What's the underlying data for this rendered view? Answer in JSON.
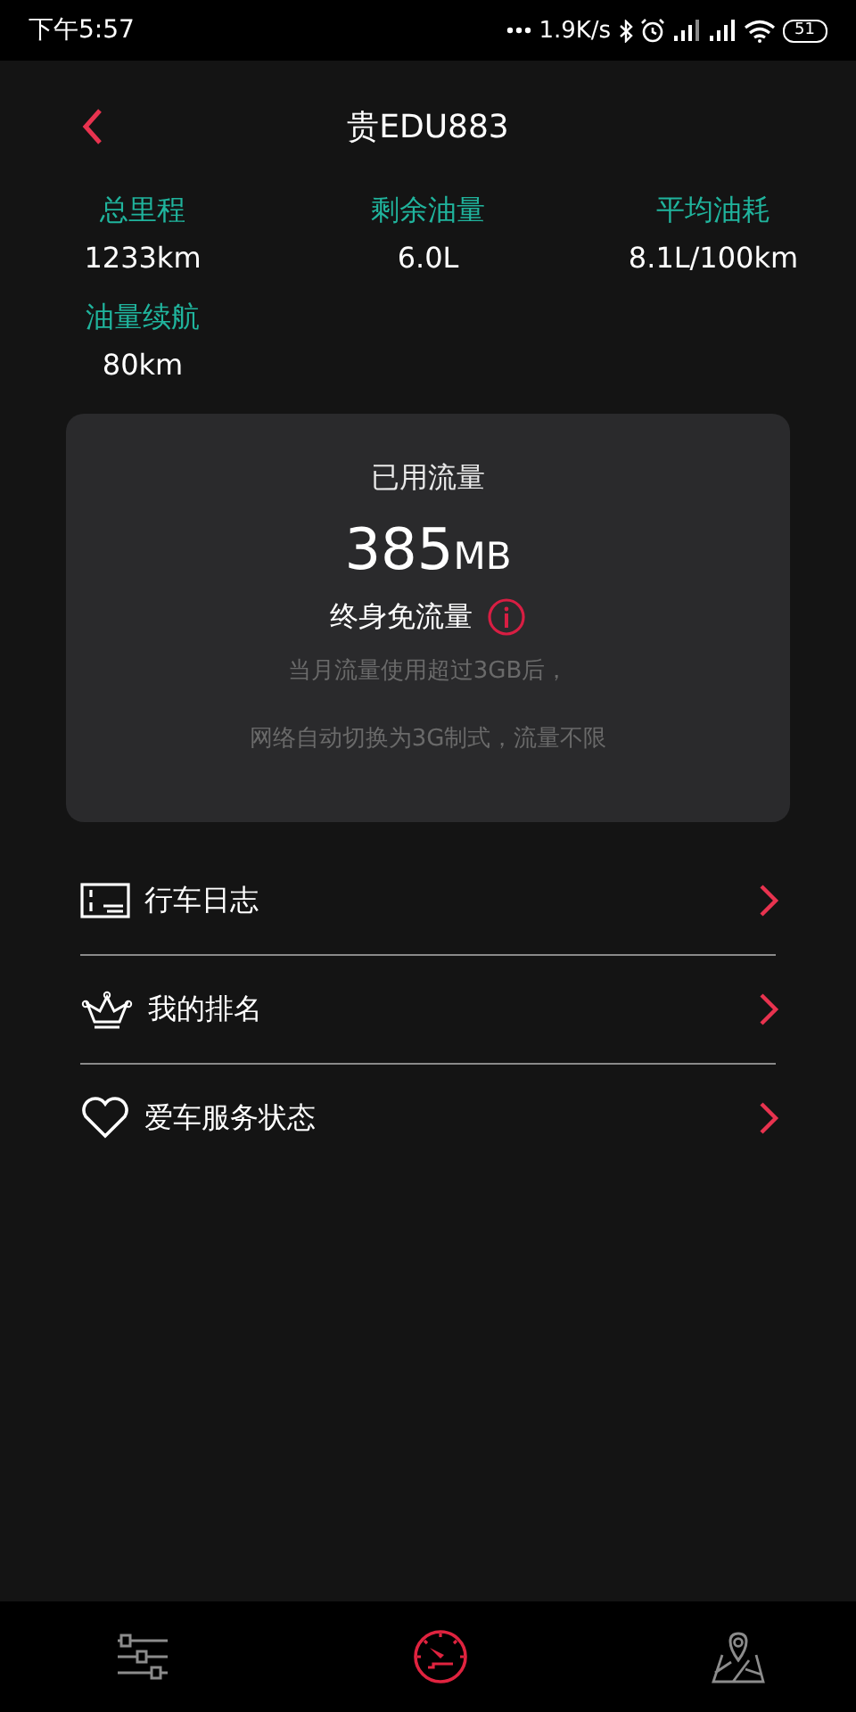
{
  "status_bar": {
    "time": "下午5:57",
    "net_speed": "1.9K/s",
    "battery": "51"
  },
  "header": {
    "title": "贵EDU883"
  },
  "stats": [
    {
      "label": "总里程",
      "value": "1233km"
    },
    {
      "label": "剩余油量",
      "value": "6.0L"
    },
    {
      "label": "平均油耗",
      "value": "8.1L/100km"
    },
    {
      "label": "油量续航",
      "value": "80km"
    }
  ],
  "data_card": {
    "title": "已用流量",
    "amount": "385",
    "unit": "MB",
    "plan": "终身免流量",
    "notes": [
      "当月流量使用超过3GB后，",
      "网络自动切换为3G制式，流量不限"
    ]
  },
  "menu": [
    {
      "kind": "log",
      "label": "行车日志"
    },
    {
      "kind": "ranking",
      "label": "我的排名"
    },
    {
      "kind": "service",
      "label": "爱车服务状态"
    }
  ],
  "bottom_nav": [
    {
      "kind": "settings",
      "selected": false
    },
    {
      "kind": "dashboard",
      "selected": true
    },
    {
      "kind": "map",
      "selected": false
    }
  ]
}
